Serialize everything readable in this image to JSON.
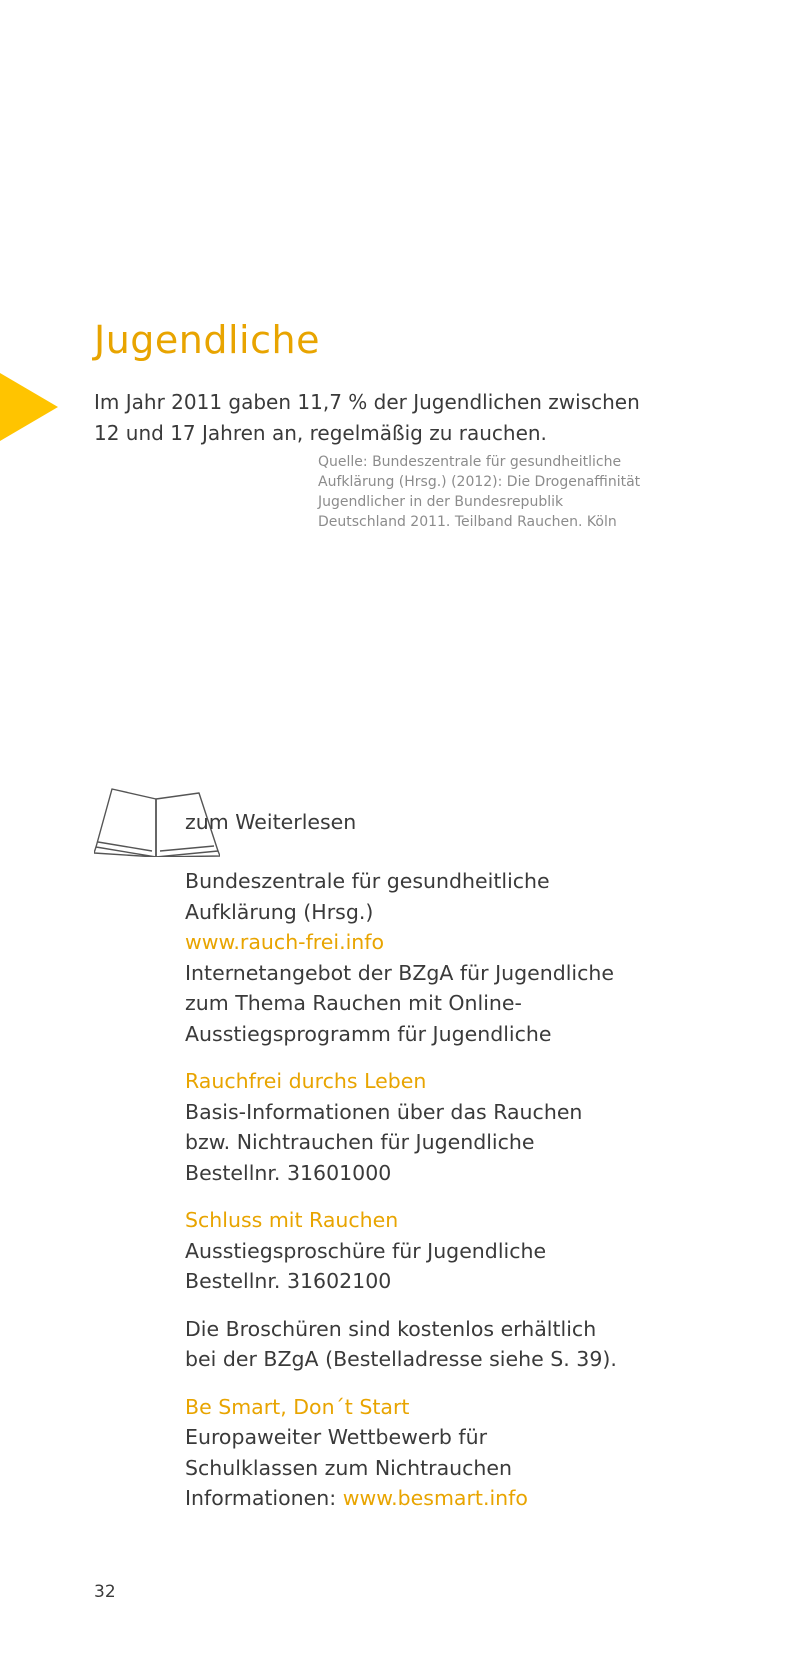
{
  "heading": "Jugendliche",
  "fact": {
    "line1": "Im Jahr 2011 gaben 11,7 % der Jugendlichen zwischen",
    "line2": "12 und 17 Jahren an, regelmäßig zu rauchen."
  },
  "source": {
    "line1": "Quelle: Bundeszentrale für gesundheitliche",
    "line2": "Aufklärung (Hrsg.) (2012): Die Drogenaffinität",
    "line3": "Jugendlicher in der Bundesrepublik",
    "line4": "Deutschland 2011. Teilband Rauchen. Köln"
  },
  "readmore": "zum Weiterlesen",
  "refs": {
    "bzga": {
      "line1": "Bundeszentrale für gesundheitliche",
      "line2": "Aufklärung (Hrsg.)",
      "link": "www.rauch-frei.info",
      "desc1": "Internetangebot der BZgA für Jugendliche",
      "desc2": "zum Thema Rauchen mit Online-",
      "desc3": "Ausstiegsprogramm für Jugendliche"
    },
    "rauchfrei": {
      "title": "Rauchfrei durchs Leben",
      "desc1": "Basis-Informationen über das Rauchen",
      "desc2": "bzw. Nichtrauchen für Jugendliche",
      "order": "Bestellnr. 31601000"
    },
    "schluss": {
      "title": "Schluss mit Rauchen",
      "desc1": "Ausstiegsproschüre für Jugendliche",
      "order": "Bestellnr. 31602100"
    },
    "note": {
      "line1": "Die Broschüren sind kostenlos erhältlich",
      "line2": "bei der BZgA (Bestelladresse siehe S. 39)."
    },
    "besmart": {
      "title": "Be Smart, Don´t Start",
      "desc1": "Europaweiter Wettbewerb für",
      "desc2": "Schulklassen zum Nichtrauchen",
      "info_label": "Informationen: ",
      "link": "www.besmart.info"
    }
  },
  "page_number": "32",
  "colors": {
    "accent": "#e8a400",
    "arrow": "#ffc400",
    "text": "#3a3a3a",
    "source": "#8c8c8c"
  }
}
